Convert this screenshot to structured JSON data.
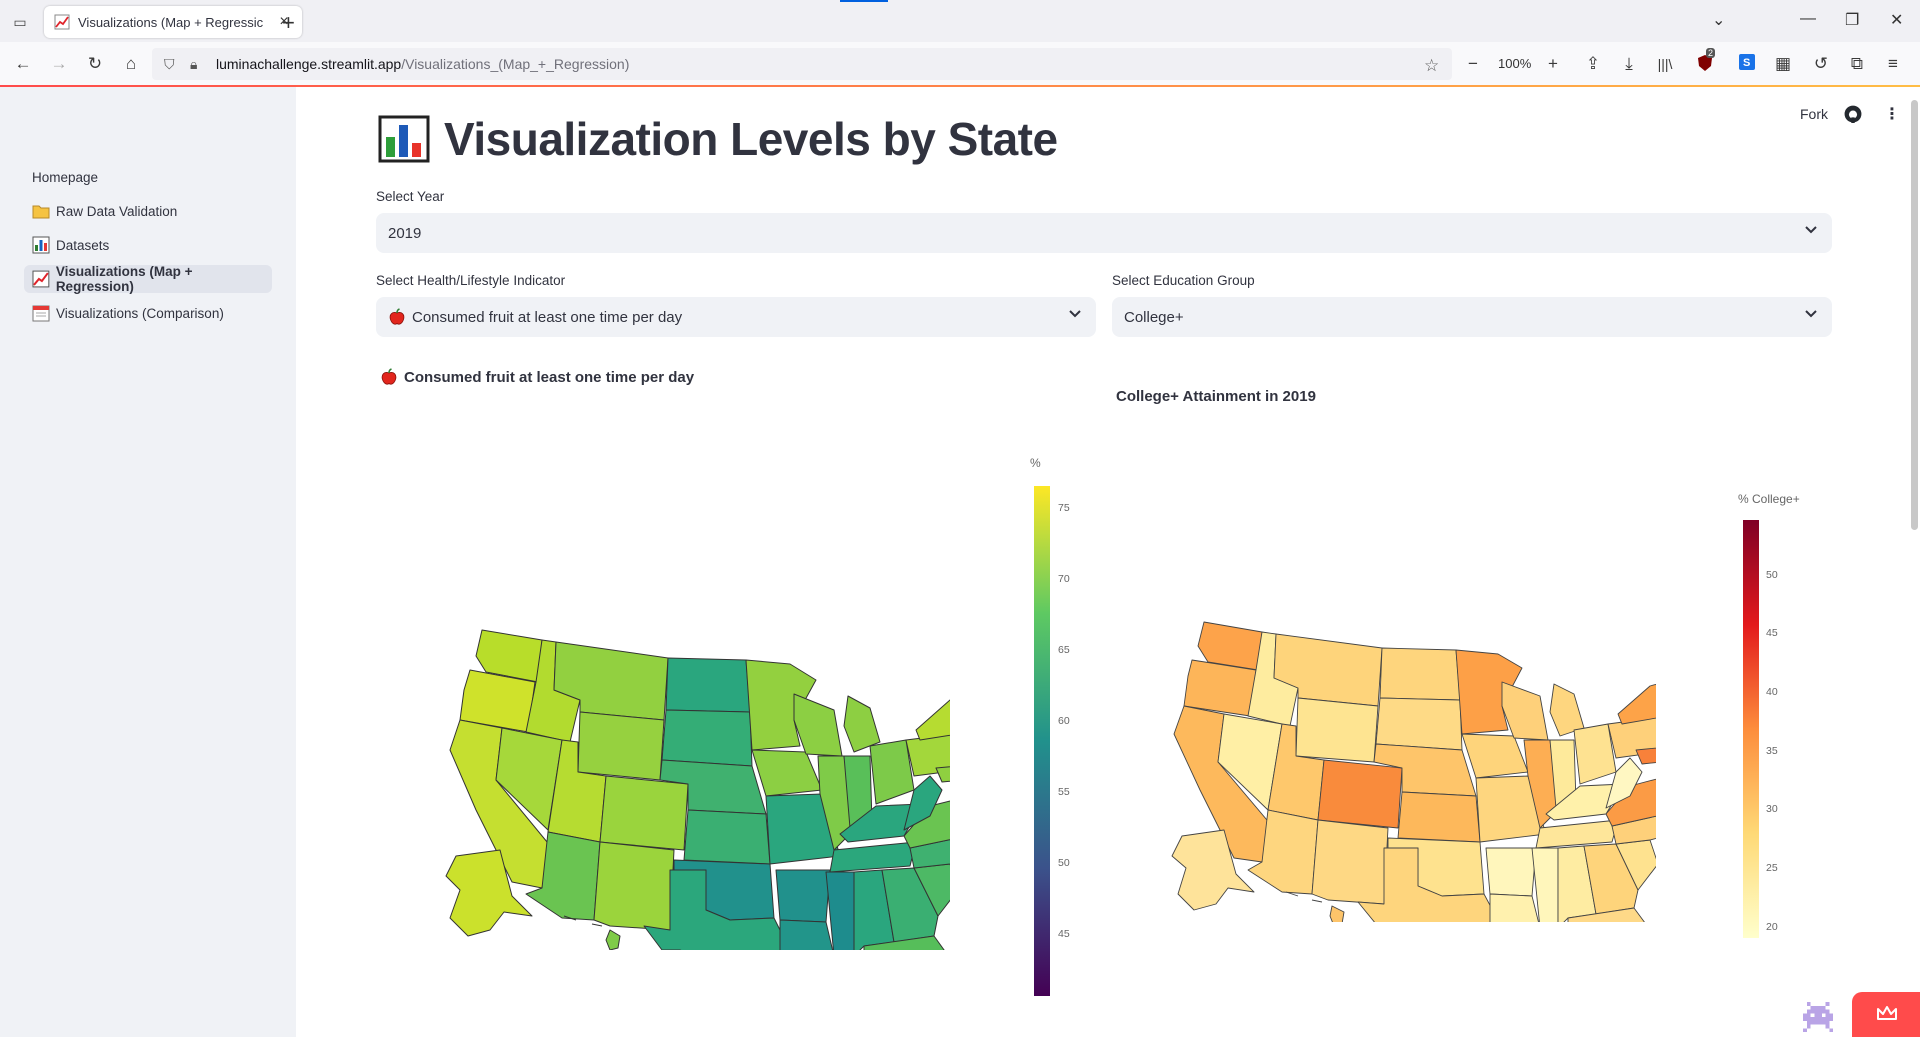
{
  "browser": {
    "tab_title": "Visualizations (Map + Regressic",
    "url_host": "luminachallenge.streamlit.app",
    "url_path": "/Visualizations_(Map_+_Regression)",
    "zoom": "100%",
    "badge_count": "2"
  },
  "sidebar": {
    "homepage": "Homepage",
    "items": [
      {
        "label": "Raw Data Validation",
        "icon": "folder-icon"
      },
      {
        "label": "Datasets",
        "icon": "bar-chart-icon"
      },
      {
        "label": "Visualizations (Map + Regression)",
        "icon": "chart-increasing-icon",
        "active": true
      },
      {
        "label": "Visualizations (Comparison)",
        "icon": "calendar-icon"
      }
    ]
  },
  "header": {
    "fork": "Fork"
  },
  "main": {
    "title": "Visualization Levels by State",
    "year_label": "Select Year",
    "year_value": "2019",
    "indicator_label": "Select Health/Lifestyle Indicator",
    "indicator_value": "Consumed fruit at least one time per day",
    "education_label": "Select Education Group",
    "education_value": "College+"
  },
  "left_map": {
    "title": "Consumed fruit at least one time per day",
    "colorbar_title": "%",
    "ticks": [
      "75",
      "70",
      "65",
      "60",
      "55",
      "50",
      "45"
    ],
    "colorscale": [
      "#440154",
      "#3b528b",
      "#21918c",
      "#5ec962",
      "#fde725"
    ],
    "range": [
      41,
      76
    ]
  },
  "right_map": {
    "title": "College+ Attainment in 2019",
    "colorbar_title": "% College+",
    "ticks": [
      "50",
      "45",
      "40",
      "35",
      "30",
      "25",
      "20"
    ],
    "colorscale": [
      "#ffffcc",
      "#fed976",
      "#fd8d3c",
      "#e31a1c",
      "#800026"
    ],
    "range": [
      19,
      55
    ]
  }
}
